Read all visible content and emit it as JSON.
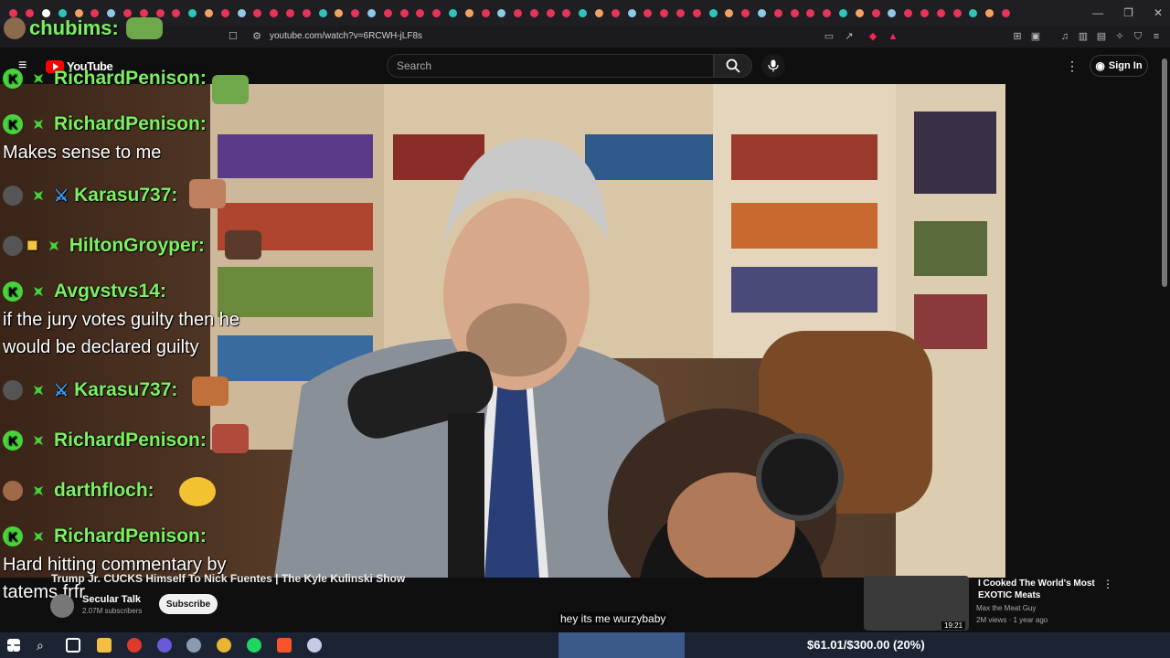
{
  "browser": {
    "url": "youtube.com/watch?v=6RCWH-jLF8s",
    "tab_count_visible": 62
  },
  "youtube": {
    "logo_text": "YouTube",
    "search_placeholder": "Search",
    "sign_in_label": "Sign In"
  },
  "stream_overlay": {
    "top_user": "chubims:",
    "chat": [
      {
        "user": "RichardPenison:",
        "message": ""
      },
      {
        "user": "RichardPenison:",
        "message": "Makes sense to me"
      },
      {
        "user": "Karasu737:",
        "message": ""
      },
      {
        "user": "HiltonGroyper:",
        "message": ""
      },
      {
        "user": "Avgvstvs14:",
        "message": "if the jury votes guilty then he"
      },
      {
        "user": "",
        "message": "would be declared guilty"
      },
      {
        "user": "Karasu737:",
        "message": ""
      },
      {
        "user": "RichardPenison:",
        "message": ""
      },
      {
        "user": "darthfloch:",
        "message": ""
      },
      {
        "user": "RichardPenison:",
        "message": "Hard hitting commentary by"
      },
      {
        "user": "",
        "message": "tatems frfr"
      }
    ]
  },
  "video": {
    "title": "Trump Jr. CUCKS Himself To Nick Fuentes | The Kyle Kulinski Show",
    "channel": "Secular Talk",
    "subscribers": "2.07M subscribers",
    "subscribe_label": "Subscribe",
    "caption": "hey its me wurzybaby"
  },
  "recommendation": {
    "title": "I Cooked The World's Most EXOTIC Meats",
    "channel": "Max the Meat Guy",
    "meta": "2M views · 1 year ago",
    "duration": "19:21"
  },
  "taskbar": {
    "donation": "$61.01/$300.00 (20%)"
  },
  "colors": {
    "chat_name": "#7cf061",
    "yt_red": "#ff0000",
    "taskbar_bg": "#1c2434"
  }
}
